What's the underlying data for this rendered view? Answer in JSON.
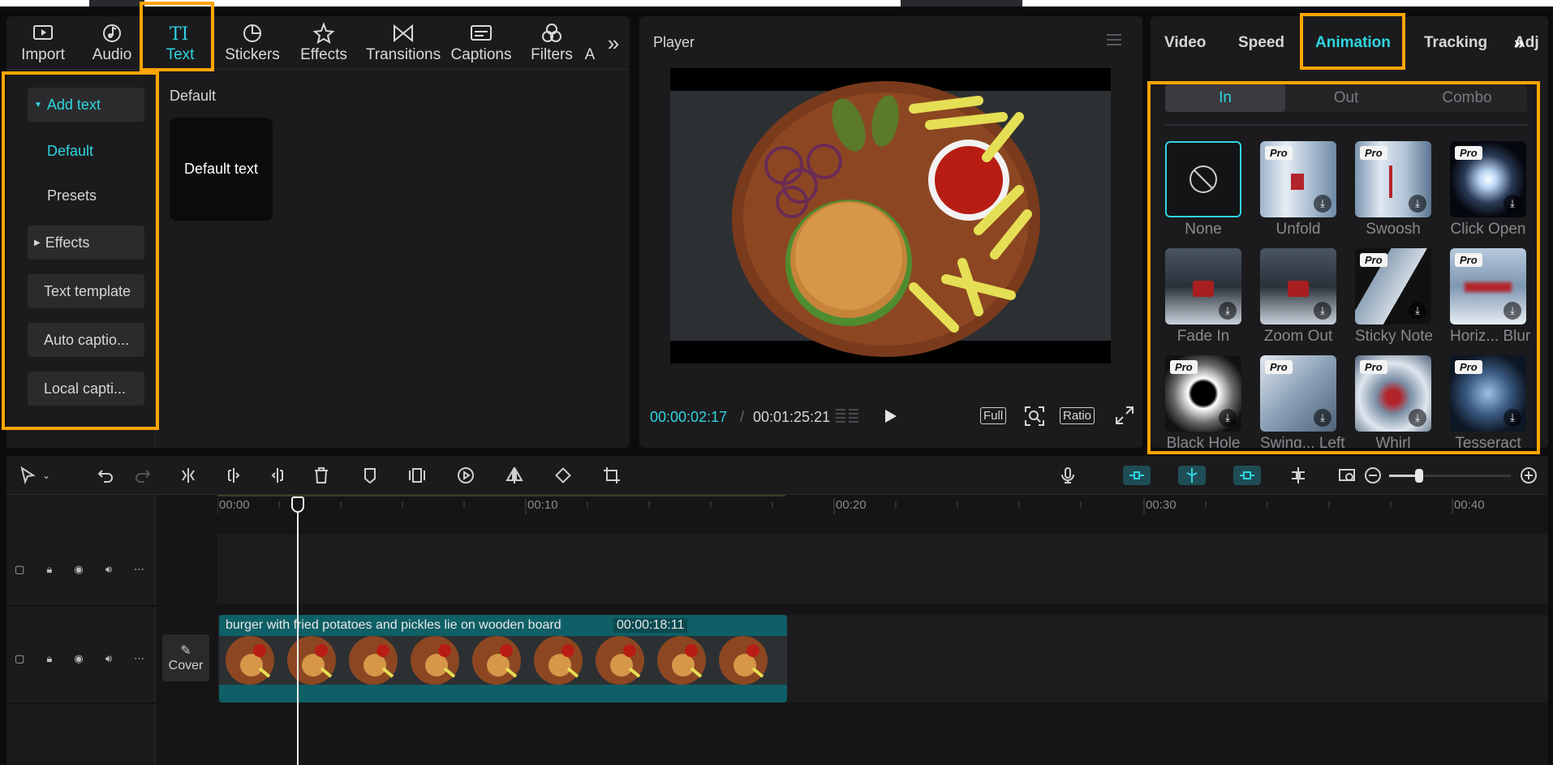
{
  "toolbar": {
    "items": [
      {
        "label": "Import",
        "icon": "import-icon"
      },
      {
        "label": "Audio",
        "icon": "audio-icon"
      },
      {
        "label": "Text",
        "icon": "text-icon",
        "active": true
      },
      {
        "label": "Stickers",
        "icon": "sticker-icon"
      },
      {
        "label": "Effects",
        "icon": "effects-icon"
      },
      {
        "label": "Transitions",
        "icon": "transitions-icon"
      },
      {
        "label": "Captions",
        "icon": "captions-icon"
      },
      {
        "label": "Filters",
        "icon": "filters-icon"
      },
      {
        "label": "A",
        "icon": "adjust-icon"
      }
    ],
    "more_icon": "double-chevron-right-icon"
  },
  "text_nav": {
    "add_text": "Add text",
    "default": "Default",
    "presets": "Presets",
    "effects": "Effects",
    "text_template": "Text template",
    "auto_captions": "Auto captio...",
    "local_captions": "Local capti..."
  },
  "text_content": {
    "section_title": "Default",
    "card_label": "Default text"
  },
  "player": {
    "title": "Player",
    "current_time": "00:00:02:17",
    "separator": "/",
    "total_time": "00:01:25:21",
    "full_label": "Full",
    "ratio_label": "Ratio"
  },
  "right_panel": {
    "tabs": [
      "Video",
      "Speed",
      "Animation",
      "Tracking",
      "Adj"
    ],
    "active_tab": "Animation",
    "segments": [
      "In",
      "Out",
      "Combo"
    ],
    "active_segment": "In",
    "animations": [
      {
        "label": "None",
        "pro": false
      },
      {
        "label": "Unfold",
        "pro": true
      },
      {
        "label": "Swoosh",
        "pro": true
      },
      {
        "label": "Click Open",
        "pro": true
      },
      {
        "label": "Fade In",
        "pro": false
      },
      {
        "label": "Zoom Out",
        "pro": false
      },
      {
        "label": "Sticky Note",
        "pro": true
      },
      {
        "label": "Horiz... Blur",
        "pro": true
      },
      {
        "label": "Black Hole",
        "pro": true
      },
      {
        "label": "Swing... Left",
        "pro": true
      },
      {
        "label": "Whirl",
        "pro": true
      },
      {
        "label": "Tesseract",
        "pro": true
      }
    ],
    "pro_badge": "Pro"
  },
  "timeline": {
    "ruler": [
      "00:00",
      "00:10",
      "00:20",
      "00:30",
      "00:40"
    ],
    "clip_title": "burger with fried potatoes and pickles lie on wooden board",
    "clip_duration": "00:00:18:11",
    "cover_label": "Cover"
  },
  "colors": {
    "accent": "#2fd5e0",
    "highlight": "#ffa500",
    "clip": "#0f5f66",
    "panel": "#1b1b1d"
  }
}
